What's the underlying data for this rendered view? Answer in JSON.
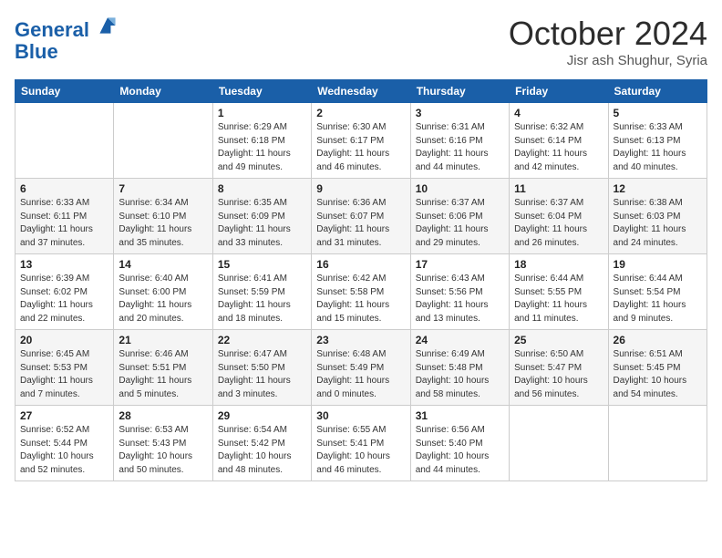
{
  "logo": {
    "line1": "General",
    "line2": "Blue"
  },
  "title": "October 2024",
  "subtitle": "Jisr ash Shughur, Syria",
  "days_header": [
    "Sunday",
    "Monday",
    "Tuesday",
    "Wednesday",
    "Thursday",
    "Friday",
    "Saturday"
  ],
  "weeks": [
    [
      {
        "num": "",
        "info": ""
      },
      {
        "num": "",
        "info": ""
      },
      {
        "num": "1",
        "info": "Sunrise: 6:29 AM\nSunset: 6:18 PM\nDaylight: 11 hours and 49 minutes."
      },
      {
        "num": "2",
        "info": "Sunrise: 6:30 AM\nSunset: 6:17 PM\nDaylight: 11 hours and 46 minutes."
      },
      {
        "num": "3",
        "info": "Sunrise: 6:31 AM\nSunset: 6:16 PM\nDaylight: 11 hours and 44 minutes."
      },
      {
        "num": "4",
        "info": "Sunrise: 6:32 AM\nSunset: 6:14 PM\nDaylight: 11 hours and 42 minutes."
      },
      {
        "num": "5",
        "info": "Sunrise: 6:33 AM\nSunset: 6:13 PM\nDaylight: 11 hours and 40 minutes."
      }
    ],
    [
      {
        "num": "6",
        "info": "Sunrise: 6:33 AM\nSunset: 6:11 PM\nDaylight: 11 hours and 37 minutes."
      },
      {
        "num": "7",
        "info": "Sunrise: 6:34 AM\nSunset: 6:10 PM\nDaylight: 11 hours and 35 minutes."
      },
      {
        "num": "8",
        "info": "Sunrise: 6:35 AM\nSunset: 6:09 PM\nDaylight: 11 hours and 33 minutes."
      },
      {
        "num": "9",
        "info": "Sunrise: 6:36 AM\nSunset: 6:07 PM\nDaylight: 11 hours and 31 minutes."
      },
      {
        "num": "10",
        "info": "Sunrise: 6:37 AM\nSunset: 6:06 PM\nDaylight: 11 hours and 29 minutes."
      },
      {
        "num": "11",
        "info": "Sunrise: 6:37 AM\nSunset: 6:04 PM\nDaylight: 11 hours and 26 minutes."
      },
      {
        "num": "12",
        "info": "Sunrise: 6:38 AM\nSunset: 6:03 PM\nDaylight: 11 hours and 24 minutes."
      }
    ],
    [
      {
        "num": "13",
        "info": "Sunrise: 6:39 AM\nSunset: 6:02 PM\nDaylight: 11 hours and 22 minutes."
      },
      {
        "num": "14",
        "info": "Sunrise: 6:40 AM\nSunset: 6:00 PM\nDaylight: 11 hours and 20 minutes."
      },
      {
        "num": "15",
        "info": "Sunrise: 6:41 AM\nSunset: 5:59 PM\nDaylight: 11 hours and 18 minutes."
      },
      {
        "num": "16",
        "info": "Sunrise: 6:42 AM\nSunset: 5:58 PM\nDaylight: 11 hours and 15 minutes."
      },
      {
        "num": "17",
        "info": "Sunrise: 6:43 AM\nSunset: 5:56 PM\nDaylight: 11 hours and 13 minutes."
      },
      {
        "num": "18",
        "info": "Sunrise: 6:44 AM\nSunset: 5:55 PM\nDaylight: 11 hours and 11 minutes."
      },
      {
        "num": "19",
        "info": "Sunrise: 6:44 AM\nSunset: 5:54 PM\nDaylight: 11 hours and 9 minutes."
      }
    ],
    [
      {
        "num": "20",
        "info": "Sunrise: 6:45 AM\nSunset: 5:53 PM\nDaylight: 11 hours and 7 minutes."
      },
      {
        "num": "21",
        "info": "Sunrise: 6:46 AM\nSunset: 5:51 PM\nDaylight: 11 hours and 5 minutes."
      },
      {
        "num": "22",
        "info": "Sunrise: 6:47 AM\nSunset: 5:50 PM\nDaylight: 11 hours and 3 minutes."
      },
      {
        "num": "23",
        "info": "Sunrise: 6:48 AM\nSunset: 5:49 PM\nDaylight: 11 hours and 0 minutes."
      },
      {
        "num": "24",
        "info": "Sunrise: 6:49 AM\nSunset: 5:48 PM\nDaylight: 10 hours and 58 minutes."
      },
      {
        "num": "25",
        "info": "Sunrise: 6:50 AM\nSunset: 5:47 PM\nDaylight: 10 hours and 56 minutes."
      },
      {
        "num": "26",
        "info": "Sunrise: 6:51 AM\nSunset: 5:45 PM\nDaylight: 10 hours and 54 minutes."
      }
    ],
    [
      {
        "num": "27",
        "info": "Sunrise: 6:52 AM\nSunset: 5:44 PM\nDaylight: 10 hours and 52 minutes."
      },
      {
        "num": "28",
        "info": "Sunrise: 6:53 AM\nSunset: 5:43 PM\nDaylight: 10 hours and 50 minutes."
      },
      {
        "num": "29",
        "info": "Sunrise: 6:54 AM\nSunset: 5:42 PM\nDaylight: 10 hours and 48 minutes."
      },
      {
        "num": "30",
        "info": "Sunrise: 6:55 AM\nSunset: 5:41 PM\nDaylight: 10 hours and 46 minutes."
      },
      {
        "num": "31",
        "info": "Sunrise: 6:56 AM\nSunset: 5:40 PM\nDaylight: 10 hours and 44 minutes."
      },
      {
        "num": "",
        "info": ""
      },
      {
        "num": "",
        "info": ""
      }
    ]
  ]
}
